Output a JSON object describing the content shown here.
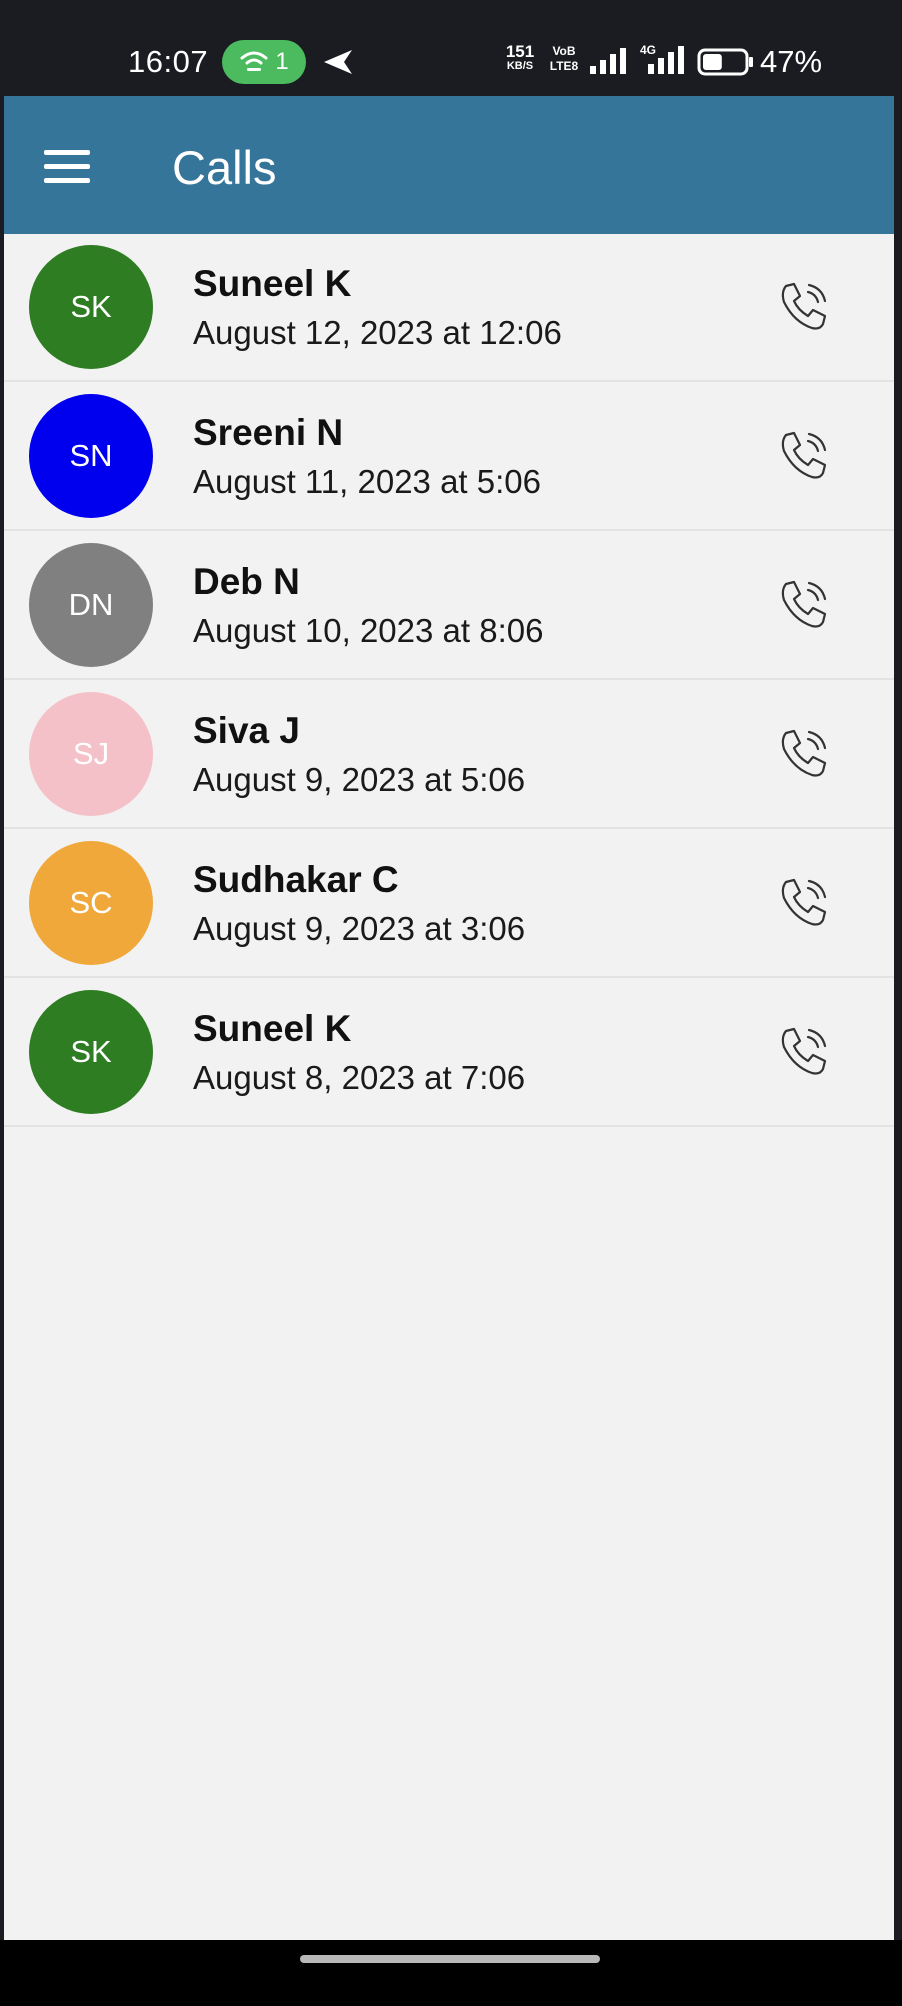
{
  "status_bar": {
    "time": "16:07",
    "hotspot_count": "1",
    "net_speed_value": "151",
    "net_speed_unit": "KB/S",
    "volte_top": "VoB",
    "volte_bottom": "LTE8",
    "network_type": "4G",
    "battery_percent": "47%",
    "battery_level": 0.47
  },
  "app_bar": {
    "title": "Calls",
    "background_color": "#35759a"
  },
  "calls": [
    {
      "initials": "SK",
      "name": "Suneel K",
      "time": "August 12, 2023 at 12:06",
      "avatar_color": "#2e7d23"
    },
    {
      "initials": "SN",
      "name": "Sreeni N",
      "time": "August 11, 2023 at 5:06",
      "avatar_color": "#0000ee"
    },
    {
      "initials": "DN",
      "name": "Deb N",
      "time": "August 10, 2023 at 8:06",
      "avatar_color": "#808080"
    },
    {
      "initials": "SJ",
      "name": "Siva J",
      "time": "August 9, 2023 at 5:06",
      "avatar_color": "#f5c1c9"
    },
    {
      "initials": "SC",
      "name": "Sudhakar C",
      "time": "August 9, 2023 at 3:06",
      "avatar_color": "#f0a83a"
    },
    {
      "initials": "SK",
      "name": "Suneel K",
      "time": "August 8, 2023 at 7:06",
      "avatar_color": "#2e7d23"
    }
  ],
  "icons": {
    "menu": "hamburger-menu-icon",
    "call": "phone-call-icon",
    "hotspot": "hotspot-icon",
    "nav_arrow": "navigation-arrow-icon",
    "battery": "battery-icon",
    "signal": "signal-bars-icon"
  }
}
